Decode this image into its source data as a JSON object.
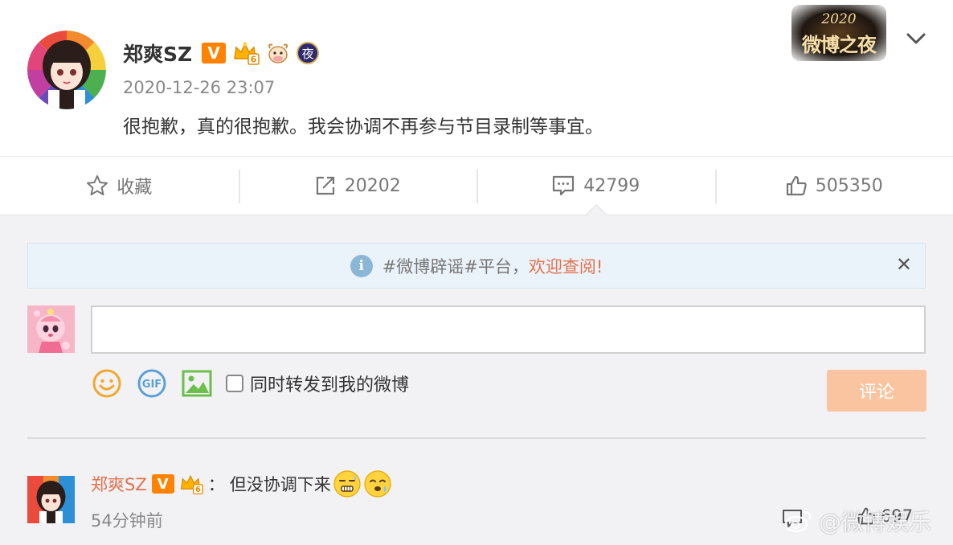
{
  "post": {
    "author": "郑爽SZ",
    "badges": {
      "verified": "V",
      "crown_level": "6",
      "night": "夜"
    },
    "time": "2020-12-26 23:07",
    "text": "很抱歉，真的很抱歉。我会协调不再参与节目录制等事宜。",
    "event_logo": {
      "year": "2020",
      "name": "微博之夜"
    }
  },
  "actions": [
    {
      "icon": "star-icon",
      "label": "收藏"
    },
    {
      "icon": "repost-icon",
      "label": "20202"
    },
    {
      "icon": "comment-icon",
      "label": "42799"
    },
    {
      "icon": "like-icon",
      "label": "505350"
    }
  ],
  "notice": {
    "icon": "info-icon",
    "text": "#微博辟谣#平台，",
    "link": "欢迎查阅!",
    "close": "✕"
  },
  "composer": {
    "input_value": "",
    "tools": [
      "emoji-icon",
      "gif-icon",
      "image-icon"
    ],
    "gif_text": "GIF",
    "repost_label": "同时转发到我的微博",
    "submit": "评论"
  },
  "comment": {
    "author": "郑爽SZ",
    "badges": {
      "verified": "V",
      "crown_level": "6"
    },
    "separator": "：",
    "text": "但没协调下来",
    "emojis": [
      "sweat-grimace-emoji",
      "sweat-sad-emoji"
    ],
    "time": "54分钟前",
    "like_count": "697"
  },
  "watermark": "@微博娱乐",
  "colors": {
    "accent": "#ff8200",
    "link": "#e2714c",
    "submit_disabled": "#fbc4a0",
    "notice_bg": "#ebf3fa",
    "page_bg": "#f2f2f5"
  }
}
